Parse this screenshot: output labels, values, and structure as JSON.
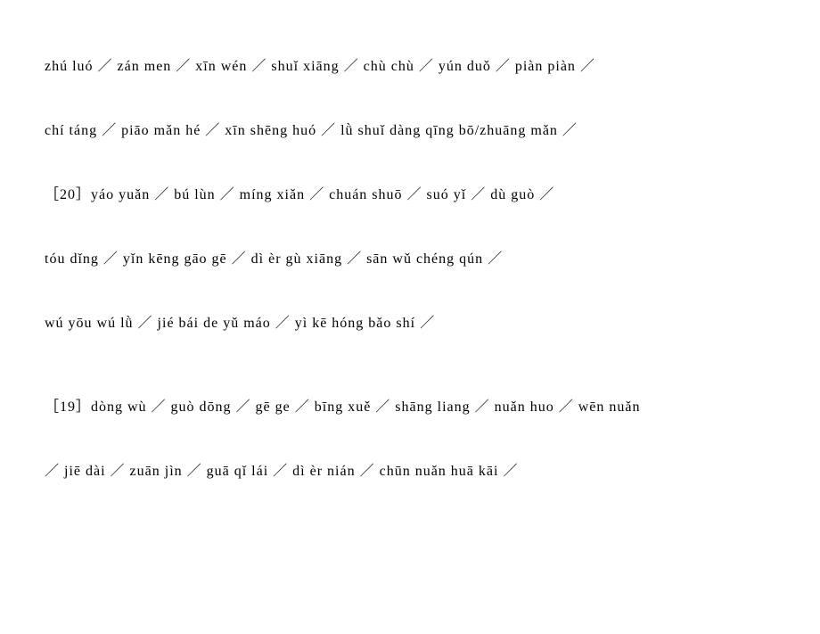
{
  "lines": [
    "zhú luó ／ zán men ／ xīn wén ／ shuǐ xiāng ／ chù chù ／ yún duǒ ／ piàn piàn ／",
    "chí táng ／ piāo mǎn hé ／ xīn shēng huó ／ lǜ shuǐ dàng qīng bō/zhuāng mǎn ／",
    "［20］yáo yuǎn ／ bú lùn ／ míng xiǎn ／ chuán shuō ／ suó yǐ ／ dù guò ／",
    "tóu dǐng ／ yǐn kēng gāo gē ／ dì èr gù xiāng ／ sān wǔ chéng qún ／",
    "wú yōu wú lǜ ／ jié bái de yǔ máo ／ yì kē hóng bǎo shí ／",
    "［19］dòng wù ／ guò dōng ／ gē ge ／ bīng xuě ／ shāng liang ／ nuǎn huo ／ wēn nuǎn",
    "／ jiē dài ／ zuān jìn ／ guā qǐ lái ／ dì èr nián ／ chūn nuǎn huā kāi ／"
  ]
}
